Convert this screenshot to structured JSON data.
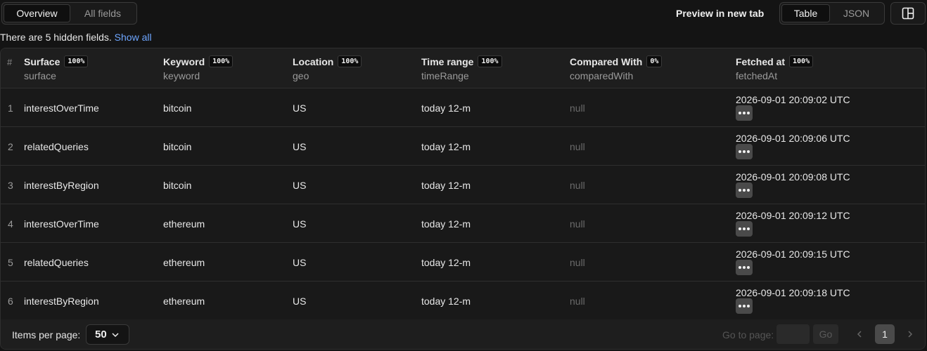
{
  "tabs": {
    "overview": "Overview",
    "all_fields": "All fields"
  },
  "preview_link": "Preview in new tab",
  "view_toggle": {
    "table": "Table",
    "json": "JSON"
  },
  "hidden_note": {
    "text": "There are 5 hidden fields.",
    "link": "Show all"
  },
  "table": {
    "hash": "#",
    "columns": [
      {
        "title": "Surface",
        "pct": "100%",
        "key": "surface"
      },
      {
        "title": "Keyword",
        "pct": "100%",
        "key": "keyword"
      },
      {
        "title": "Location",
        "pct": "100%",
        "key": "geo"
      },
      {
        "title": "Time range",
        "pct": "100%",
        "key": "timeRange"
      },
      {
        "title": "Compared With",
        "pct": "0%",
        "key": "comparedWith"
      },
      {
        "title": "Fetched at",
        "pct": "100%",
        "key": "fetchedAt"
      }
    ],
    "rows": [
      {
        "num": "1",
        "surface": "interestOverTime",
        "keyword": "bitcoin",
        "geo": "US",
        "timeRange": "today 12-m",
        "comparedWith": "null",
        "fetchedAt": "2026-09-01 20:09:02 UTC"
      },
      {
        "num": "2",
        "surface": "relatedQueries",
        "keyword": "bitcoin",
        "geo": "US",
        "timeRange": "today 12-m",
        "comparedWith": "null",
        "fetchedAt": "2026-09-01 20:09:06 UTC"
      },
      {
        "num": "3",
        "surface": "interestByRegion",
        "keyword": "bitcoin",
        "geo": "US",
        "timeRange": "today 12-m",
        "comparedWith": "null",
        "fetchedAt": "2026-09-01 20:09:08 UTC"
      },
      {
        "num": "4",
        "surface": "interestOverTime",
        "keyword": "ethereum",
        "geo": "US",
        "timeRange": "today 12-m",
        "comparedWith": "null",
        "fetchedAt": "2026-09-01 20:09:12 UTC"
      },
      {
        "num": "5",
        "surface": "relatedQueries",
        "keyword": "ethereum",
        "geo": "US",
        "timeRange": "today 12-m",
        "comparedWith": "null",
        "fetchedAt": "2026-09-01 20:09:15 UTC"
      },
      {
        "num": "6",
        "surface": "interestByRegion",
        "keyword": "ethereum",
        "geo": "US",
        "timeRange": "today 12-m",
        "comparedWith": "null",
        "fetchedAt": "2026-09-01 20:09:18 UTC"
      }
    ]
  },
  "footer": {
    "items_per_page_label": "Items per page:",
    "items_per_page_value": "50",
    "goto_label": "Go to page:",
    "go_label": "Go",
    "current_page": "1"
  },
  "icons": {
    "layout": "layout-panels-icon",
    "chevron_down": "chevron-down-icon",
    "prev": "chevron-left-icon",
    "next": "chevron-right-icon",
    "more": "more-horizontal-icon"
  }
}
